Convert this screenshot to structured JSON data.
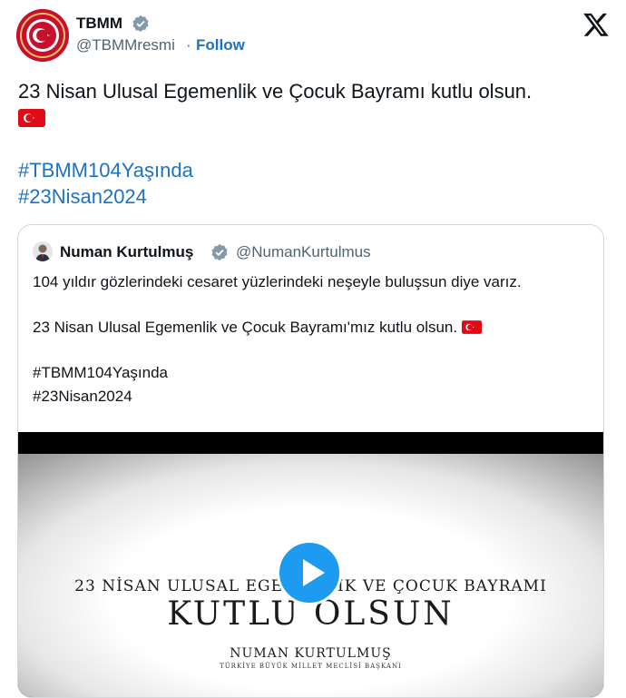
{
  "author": {
    "name": "TBMM",
    "handle": "@TBMMresmi",
    "separator": "·",
    "follow_label": "Follow",
    "avatar_icon": "tbmm-emblem-icon",
    "verified_icon": "verified-badge-icon"
  },
  "brand_logo": "x-logo-icon",
  "tweet": {
    "line1": "23 Nisan Ulusal Egemenlik ve Çocuk Bayramı kutlu olsun.",
    "flag_icon": "turkey-flag-icon",
    "hashtag1": "#TBMM104Yaşında",
    "hashtag2": "#23Nisan2024"
  },
  "quoted": {
    "name": "Numan Kurtulmuş",
    "handle": "@NumanKurtulmus",
    "text1": "104 yıldır gözlerindeki cesaret yüzlerindeki neşeyle buluşsun diye varız.",
    "text2": "23 Nisan Ulusal Egemenlik ve Çocuk Bayramı'mız kutlu olsun.",
    "hashtag1": "#TBMM104Yaşında",
    "hashtag2": "#23Nisan2024",
    "video": {
      "line1": "23 NİSAN ULUSAL EGEMENLİK VE ÇOCUK BAYRAMI",
      "line2": "KUTLU OLSUN",
      "line3": "NUMAN KURTULMUŞ",
      "line4": "TÜRKİYE BÜYÜK MİLLET MECLİSİ BAŞKANI",
      "play_icon": "play-icon"
    }
  },
  "colors": {
    "link": "#1d72c3",
    "verified": "#829aab",
    "play": "#1d9bf0",
    "flag_red": "#e30a17"
  }
}
